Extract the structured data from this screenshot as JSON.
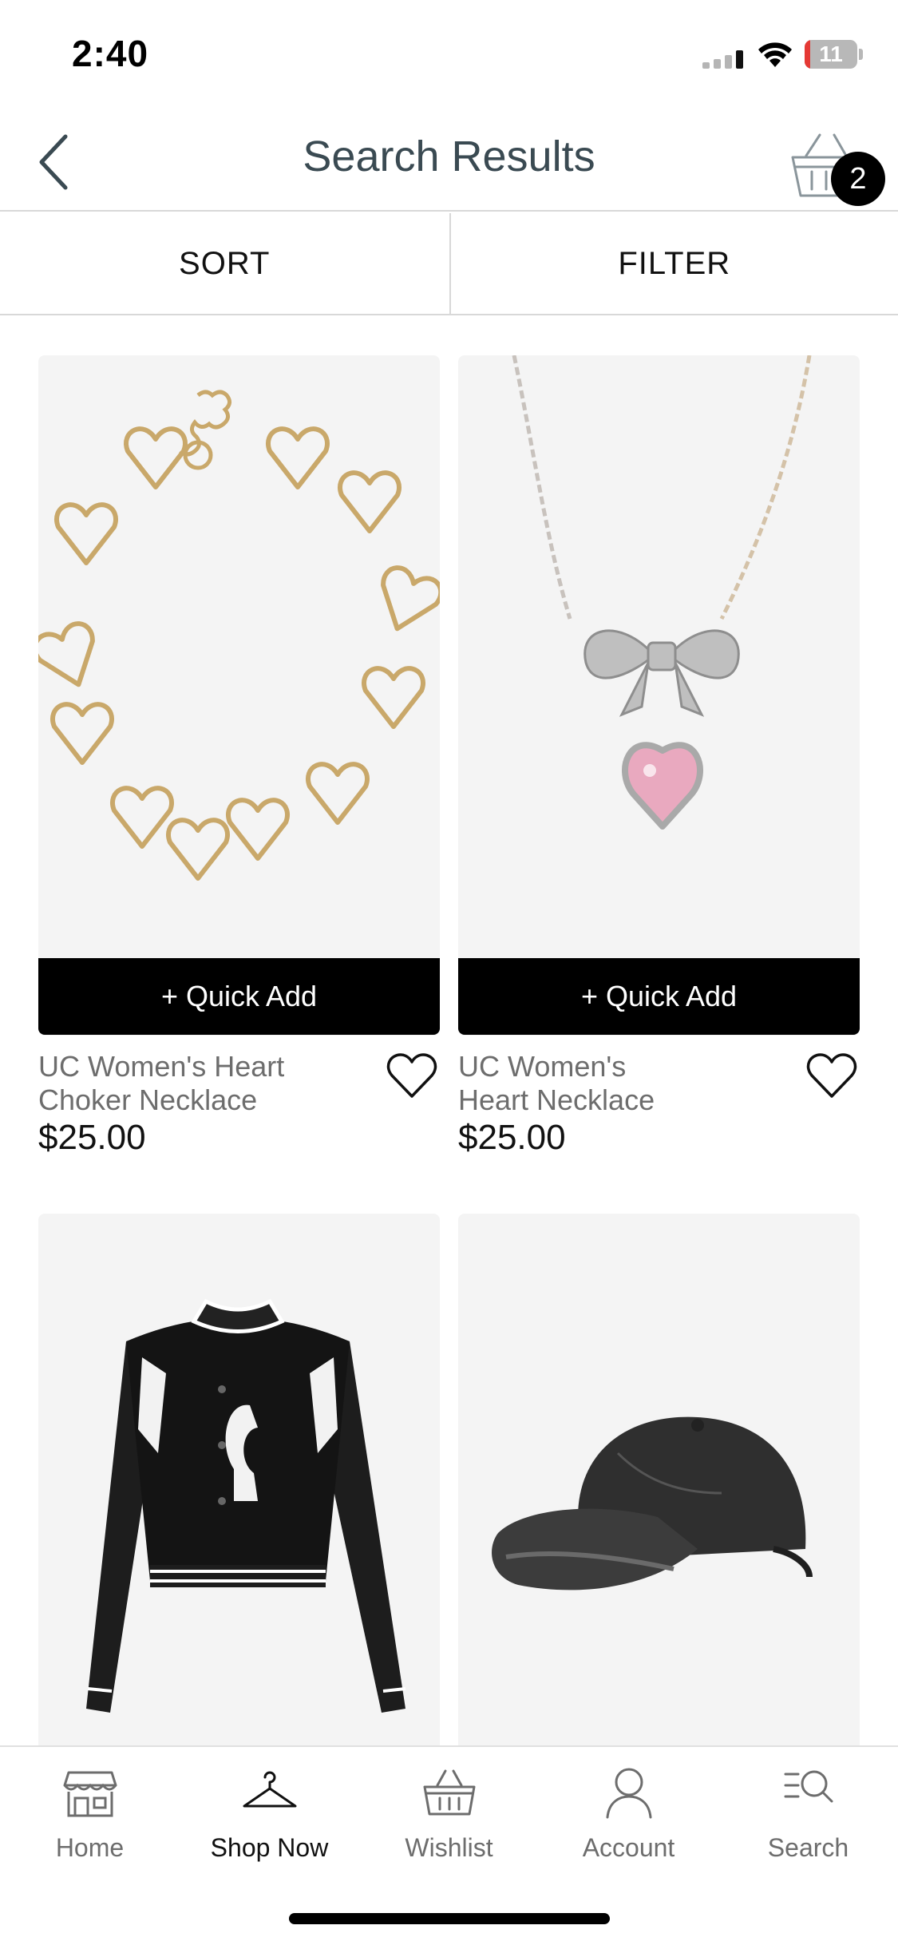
{
  "status_bar": {
    "time": "2:40",
    "battery_level": "11",
    "battery_fraction": 0.11
  },
  "header": {
    "title": "Search Results",
    "cart_count": "2"
  },
  "toolbar": {
    "sort_label": "SORT",
    "filter_label": "FILTER"
  },
  "products": [
    {
      "quick_add": "+ Quick Add",
      "name": "UC Women's Heart Choker Necklace",
      "price": "$25.00",
      "image": "gold-heart-choker-necklace"
    },
    {
      "quick_add": "+ Quick Add",
      "name": "UC Women's Heart Necklace",
      "price": "$25.00",
      "image": "silver-bow-pink-heart-pendant-necklace"
    },
    {
      "image": "black-white-varsity-jacket"
    },
    {
      "image": "black-distressed-baseball-cap"
    }
  ],
  "tab_bar": {
    "items": [
      {
        "label": "Home",
        "icon": "storefront-icon",
        "active": false
      },
      {
        "label": "Shop Now",
        "icon": "hanger-icon",
        "active": true
      },
      {
        "label": "Wishlist",
        "icon": "basket-icon",
        "active": false
      },
      {
        "label": "Account",
        "icon": "person-icon",
        "active": false
      },
      {
        "label": "Search",
        "icon": "search-list-icon",
        "active": false
      }
    ]
  },
  "colors": {
    "accent": "#000000",
    "battery_low": "#e53935",
    "muted_text": "#6d6d6d",
    "image_bg": "#f4f4f4"
  }
}
